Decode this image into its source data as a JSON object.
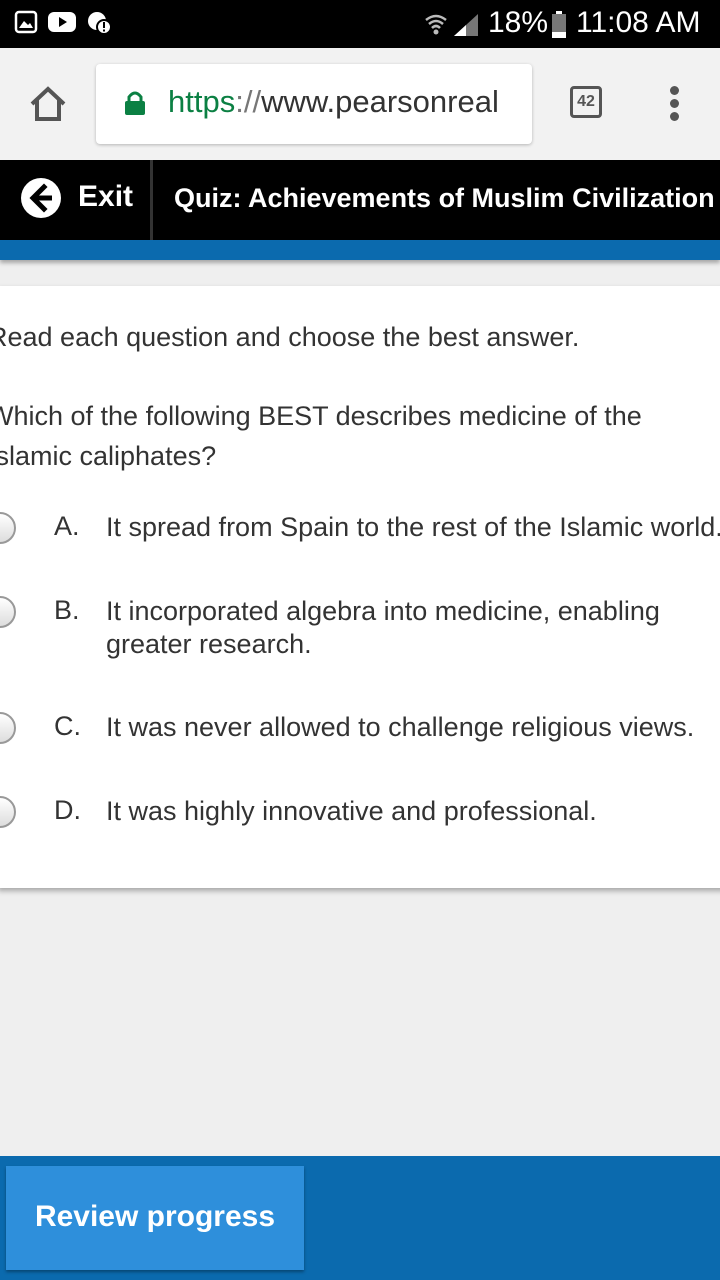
{
  "status_bar": {
    "battery": "18%",
    "time": "11:08 AM"
  },
  "browser": {
    "url_scheme": "https",
    "url_sep": "://",
    "url_host": "www.pearsonreal",
    "tab_count": "42"
  },
  "quiz_header": {
    "exit_label": "Exit",
    "title": "Quiz: Achievements of Muslim Civilization"
  },
  "content": {
    "instructions": "Read each question and choose the best answer.",
    "question": "Which of the following BEST describes medicine of the Islamic caliphates?",
    "options": [
      {
        "letter": "A.",
        "text": "It spread from Spain to the rest of the Islamic world."
      },
      {
        "letter": "B.",
        "text": "It incorporated algebra into medicine, enabling greater research."
      },
      {
        "letter": "C.",
        "text": "It was never allowed to challenge religious views."
      },
      {
        "letter": "D.",
        "text": "It was highly innovative and professional."
      }
    ]
  },
  "footer": {
    "review_label": "Review progress"
  },
  "colors": {
    "accent_blue": "#0b6aae",
    "button_blue": "#2e8fdb",
    "secure_green": "#0b8043"
  }
}
